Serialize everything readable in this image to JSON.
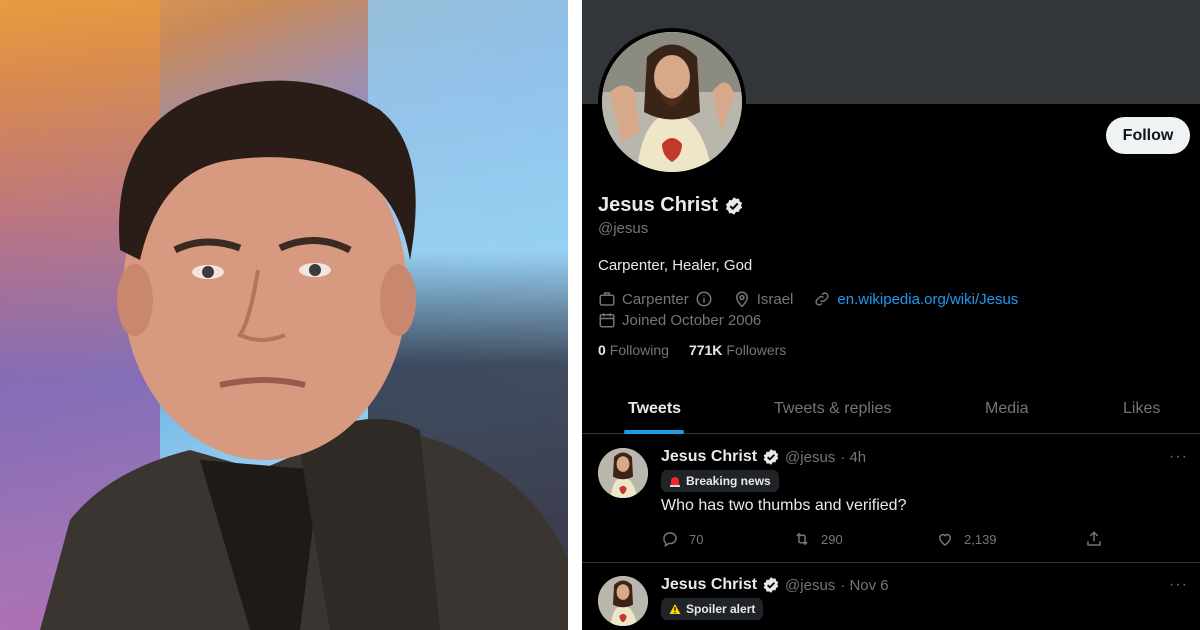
{
  "profile": {
    "name": "Jesus Christ",
    "handle": "@jesus",
    "bio": "Carpenter, Healer, God",
    "profession": "Carpenter",
    "location": "Israel",
    "website": "en.wikipedia.org/wiki/Jesus",
    "joined": "Joined October 2006",
    "following_count": "0",
    "following_label": "Following",
    "followers_count": "771K",
    "followers_label": "Followers",
    "follow_label": "Follow"
  },
  "tabs": [
    {
      "label": "Tweets",
      "active": true
    },
    {
      "label": "Tweets & replies",
      "active": false
    },
    {
      "label": "Media",
      "active": false
    },
    {
      "label": "Likes",
      "active": false
    }
  ],
  "tweets": [
    {
      "name": "Jesus Christ",
      "handle": "@jesus",
      "time": "· 4h",
      "badge": "Breaking news",
      "badge_icon": "siren-icon",
      "text": "Who has two thumbs and verified?",
      "replies": "70",
      "retweets": "290",
      "likes": "2,139",
      "more": "···"
    },
    {
      "name": "Jesus Christ",
      "handle": "@jesus",
      "time": "· Nov 6",
      "badge": "Spoiler alert",
      "badge_icon": "warning-icon",
      "more": "···"
    }
  ],
  "colors": {
    "accent": "#1d9bf0",
    "background": "#000000",
    "banner": "#333639",
    "muted": "#71767b"
  }
}
